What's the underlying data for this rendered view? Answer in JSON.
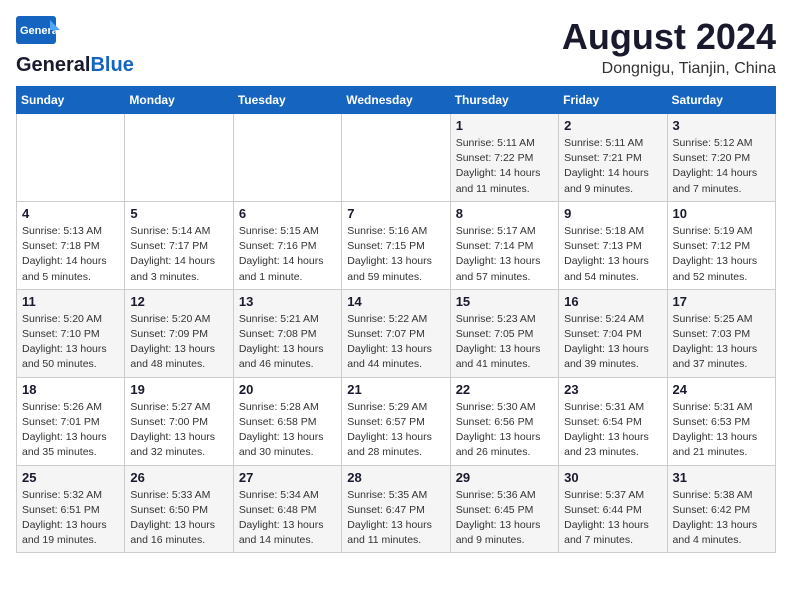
{
  "header": {
    "logo_general": "General",
    "logo_blue": "Blue",
    "main_title": "August 2024",
    "subtitle": "Dongnigu, Tianjin, China"
  },
  "calendar": {
    "days_of_week": [
      "Sunday",
      "Monday",
      "Tuesday",
      "Wednesday",
      "Thursday",
      "Friday",
      "Saturday"
    ],
    "weeks": [
      [
        {
          "day": "",
          "info": ""
        },
        {
          "day": "",
          "info": ""
        },
        {
          "day": "",
          "info": ""
        },
        {
          "day": "",
          "info": ""
        },
        {
          "day": "1",
          "info": "Sunrise: 5:11 AM\nSunset: 7:22 PM\nDaylight: 14 hours\nand 11 minutes."
        },
        {
          "day": "2",
          "info": "Sunrise: 5:11 AM\nSunset: 7:21 PM\nDaylight: 14 hours\nand 9 minutes."
        },
        {
          "day": "3",
          "info": "Sunrise: 5:12 AM\nSunset: 7:20 PM\nDaylight: 14 hours\nand 7 minutes."
        }
      ],
      [
        {
          "day": "4",
          "info": "Sunrise: 5:13 AM\nSunset: 7:18 PM\nDaylight: 14 hours\nand 5 minutes."
        },
        {
          "day": "5",
          "info": "Sunrise: 5:14 AM\nSunset: 7:17 PM\nDaylight: 14 hours\nand 3 minutes."
        },
        {
          "day": "6",
          "info": "Sunrise: 5:15 AM\nSunset: 7:16 PM\nDaylight: 14 hours\nand 1 minute."
        },
        {
          "day": "7",
          "info": "Sunrise: 5:16 AM\nSunset: 7:15 PM\nDaylight: 13 hours\nand 59 minutes."
        },
        {
          "day": "8",
          "info": "Sunrise: 5:17 AM\nSunset: 7:14 PM\nDaylight: 13 hours\nand 57 minutes."
        },
        {
          "day": "9",
          "info": "Sunrise: 5:18 AM\nSunset: 7:13 PM\nDaylight: 13 hours\nand 54 minutes."
        },
        {
          "day": "10",
          "info": "Sunrise: 5:19 AM\nSunset: 7:12 PM\nDaylight: 13 hours\nand 52 minutes."
        }
      ],
      [
        {
          "day": "11",
          "info": "Sunrise: 5:20 AM\nSunset: 7:10 PM\nDaylight: 13 hours\nand 50 minutes."
        },
        {
          "day": "12",
          "info": "Sunrise: 5:20 AM\nSunset: 7:09 PM\nDaylight: 13 hours\nand 48 minutes."
        },
        {
          "day": "13",
          "info": "Sunrise: 5:21 AM\nSunset: 7:08 PM\nDaylight: 13 hours\nand 46 minutes."
        },
        {
          "day": "14",
          "info": "Sunrise: 5:22 AM\nSunset: 7:07 PM\nDaylight: 13 hours\nand 44 minutes."
        },
        {
          "day": "15",
          "info": "Sunrise: 5:23 AM\nSunset: 7:05 PM\nDaylight: 13 hours\nand 41 minutes."
        },
        {
          "day": "16",
          "info": "Sunrise: 5:24 AM\nSunset: 7:04 PM\nDaylight: 13 hours\nand 39 minutes."
        },
        {
          "day": "17",
          "info": "Sunrise: 5:25 AM\nSunset: 7:03 PM\nDaylight: 13 hours\nand 37 minutes."
        }
      ],
      [
        {
          "day": "18",
          "info": "Sunrise: 5:26 AM\nSunset: 7:01 PM\nDaylight: 13 hours\nand 35 minutes."
        },
        {
          "day": "19",
          "info": "Sunrise: 5:27 AM\nSunset: 7:00 PM\nDaylight: 13 hours\nand 32 minutes."
        },
        {
          "day": "20",
          "info": "Sunrise: 5:28 AM\nSunset: 6:58 PM\nDaylight: 13 hours\nand 30 minutes."
        },
        {
          "day": "21",
          "info": "Sunrise: 5:29 AM\nSunset: 6:57 PM\nDaylight: 13 hours\nand 28 minutes."
        },
        {
          "day": "22",
          "info": "Sunrise: 5:30 AM\nSunset: 6:56 PM\nDaylight: 13 hours\nand 26 minutes."
        },
        {
          "day": "23",
          "info": "Sunrise: 5:31 AM\nSunset: 6:54 PM\nDaylight: 13 hours\nand 23 minutes."
        },
        {
          "day": "24",
          "info": "Sunrise: 5:31 AM\nSunset: 6:53 PM\nDaylight: 13 hours\nand 21 minutes."
        }
      ],
      [
        {
          "day": "25",
          "info": "Sunrise: 5:32 AM\nSunset: 6:51 PM\nDaylight: 13 hours\nand 19 minutes."
        },
        {
          "day": "26",
          "info": "Sunrise: 5:33 AM\nSunset: 6:50 PM\nDaylight: 13 hours\nand 16 minutes."
        },
        {
          "day": "27",
          "info": "Sunrise: 5:34 AM\nSunset: 6:48 PM\nDaylight: 13 hours\nand 14 minutes."
        },
        {
          "day": "28",
          "info": "Sunrise: 5:35 AM\nSunset: 6:47 PM\nDaylight: 13 hours\nand 11 minutes."
        },
        {
          "day": "29",
          "info": "Sunrise: 5:36 AM\nSunset: 6:45 PM\nDaylight: 13 hours\nand 9 minutes."
        },
        {
          "day": "30",
          "info": "Sunrise: 5:37 AM\nSunset: 6:44 PM\nDaylight: 13 hours\nand 7 minutes."
        },
        {
          "day": "31",
          "info": "Sunrise: 5:38 AM\nSunset: 6:42 PM\nDaylight: 13 hours\nand 4 minutes."
        }
      ]
    ]
  }
}
